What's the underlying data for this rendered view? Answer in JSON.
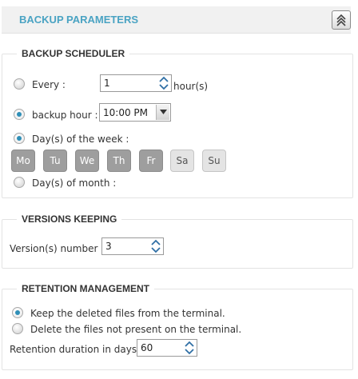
{
  "header": {
    "title": "BACKUP PARAMETERS"
  },
  "scheduler": {
    "title": "BACKUP SCHEDULER",
    "every_label": "Every :",
    "every_value": "1",
    "every_unit": "hour(s)",
    "backup_hour_label": "backup hour :",
    "backup_hour_value": "10:00 PM",
    "days_of_week_label": "Day(s) of the week :",
    "days": [
      {
        "label": "Mo",
        "selected": true
      },
      {
        "label": "Tu",
        "selected": true
      },
      {
        "label": "We",
        "selected": true
      },
      {
        "label": "Th",
        "selected": true
      },
      {
        "label": "Fr",
        "selected": true
      },
      {
        "label": "Sa",
        "selected": false
      },
      {
        "label": "Su",
        "selected": false
      }
    ],
    "days_of_month_label": "Day(s) of month :"
  },
  "versions": {
    "title": "VERSIONS KEEPING",
    "number_label": "Version(s) number :",
    "number_value": "3"
  },
  "retention": {
    "title": "RETENTION MANAGEMENT",
    "keep_label": "Keep the deleted files from the terminal.",
    "delete_label": "Delete the files not present on the terminal.",
    "duration_label": "Retention duration in days :",
    "duration_value": "60"
  },
  "colors": {
    "accent": "#4aa3c3",
    "radio_dot": "#2f8fb7",
    "day_selected": "#9e9e9e",
    "day_unselected": "#e4e4e4"
  }
}
